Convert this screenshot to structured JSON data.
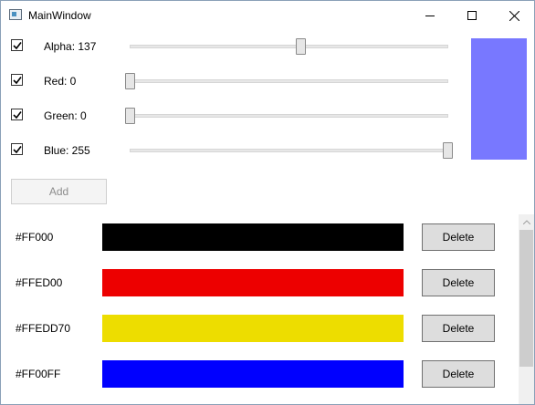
{
  "window": {
    "title": "MainWindow"
  },
  "icons": {
    "app": "app-window-icon",
    "minimize": "minimize-icon",
    "maximize": "maximize-icon",
    "close": "close-icon",
    "check": "checkmark-icon",
    "scroll_up": "chevron-up-icon"
  },
  "sliders": [
    {
      "label": "Alpha: 137",
      "checked": true,
      "value": 137,
      "min": 0,
      "max": 255
    },
    {
      "label": "Red: 0",
      "checked": true,
      "value": 0,
      "min": 0,
      "max": 255
    },
    {
      "label": "Green: 0",
      "checked": true,
      "value": 0,
      "min": 0,
      "max": 255
    },
    {
      "label": "Blue: 255",
      "checked": true,
      "value": 255,
      "min": 0,
      "max": 255
    }
  ],
  "preview_color": "#7878ff",
  "add_button": {
    "label": "Add",
    "enabled": false
  },
  "color_list": [
    {
      "hex": "#FF000",
      "color": "#000000",
      "delete_label": "Delete"
    },
    {
      "hex": "#FFED00",
      "color": "#ed0000",
      "delete_label": "Delete"
    },
    {
      "hex": "#FFEDD70",
      "color": "#eddd00",
      "delete_label": "Delete"
    },
    {
      "hex": "#FF00FF",
      "color": "#0000ff",
      "delete_label": "Delete"
    }
  ]
}
